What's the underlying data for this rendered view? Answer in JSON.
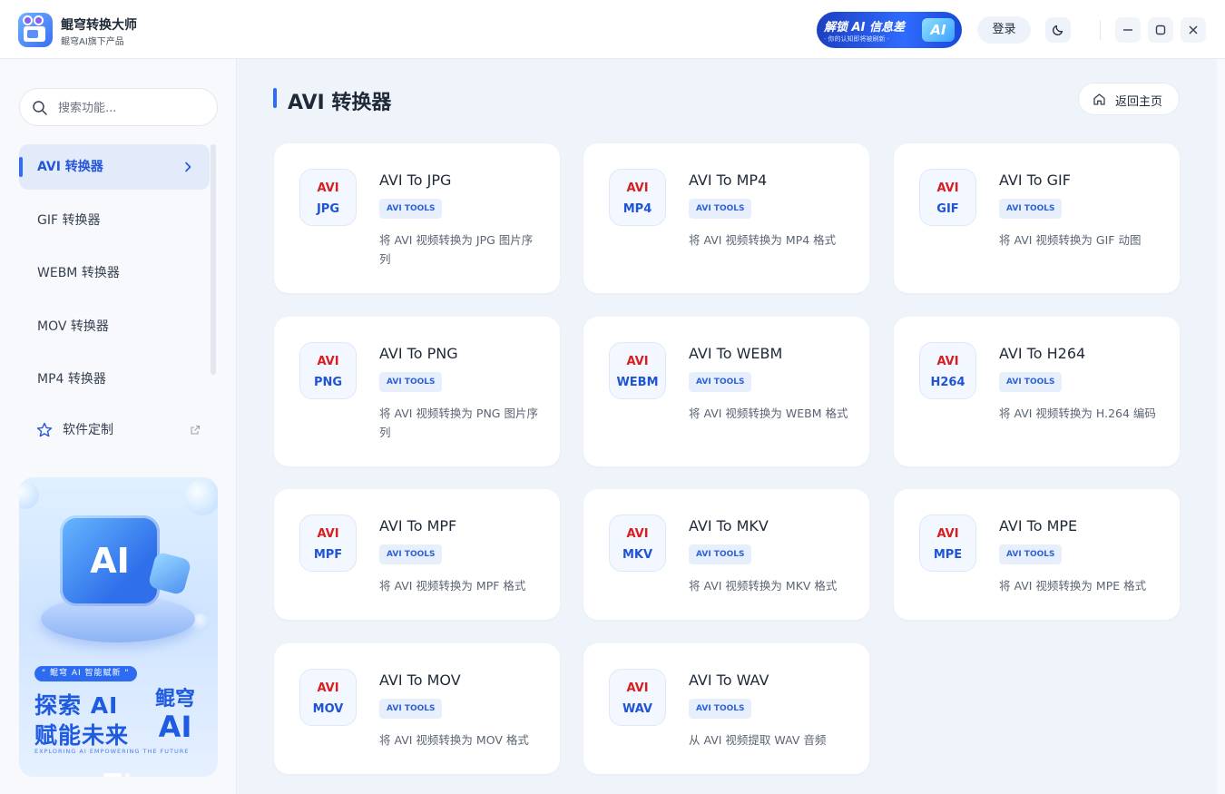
{
  "app": {
    "name": "鲲穹转换大师",
    "subtitle": "鲲穹AI旗下产品"
  },
  "promo": {
    "title": "解锁 AI 信息差",
    "subtitle": "· 你的认知即将被刷新 ·",
    "badge": "AI"
  },
  "titlebar": {
    "login_label": "登录",
    "theme_icon": "moon-icon",
    "minimize_icon": "minimize-icon",
    "maximize_icon": "maximize-icon",
    "close_icon": "close-icon"
  },
  "search": {
    "placeholder": "搜索功能..."
  },
  "sidebar": {
    "items": [
      {
        "label": "AVI 转换器",
        "active": true
      },
      {
        "label": "GIF 转换器"
      },
      {
        "label": "WEBM 转换器"
      },
      {
        "label": "MOV 转换器"
      },
      {
        "label": "MP4 转换器"
      }
    ],
    "custom_label": "软件定制"
  },
  "ad": {
    "cube_text": "AI",
    "tag": "\" 鲲穹 AI  智能赋新 \"",
    "line1": "探索 AI",
    "line2": "赋能未来",
    "brand_top": "鲲穹",
    "brand_big": "AI",
    "english": "EXPLORING AI EMPOWERING THE FUTURE"
  },
  "main": {
    "title": "AVI 转换器",
    "home_label": "返回主页"
  },
  "colors": {
    "accent": "#2f6bff",
    "source_format": "#d71f1f",
    "target_format": "#1f54d6"
  },
  "cards": [
    {
      "src": "AVI",
      "dst": "JPG",
      "title": "AVI To JPG",
      "tag": "AVI TOOLS",
      "desc": "将 AVI 视频转换为 JPG 图片序列"
    },
    {
      "src": "AVI",
      "dst": "MP4",
      "title": "AVI To MP4",
      "tag": "AVI TOOLS",
      "desc": "将 AVI 视频转换为 MP4 格式"
    },
    {
      "src": "AVI",
      "dst": "GIF",
      "title": "AVI To GIF",
      "tag": "AVI TOOLS",
      "desc": "将 AVI 视频转换为 GIF 动图"
    },
    {
      "src": "AVI",
      "dst": "PNG",
      "title": "AVI To PNG",
      "tag": "AVI TOOLS",
      "desc": "将 AVI 视频转换为 PNG 图片序列"
    },
    {
      "src": "AVI",
      "dst": "WEBM",
      "title": "AVI To WEBM",
      "tag": "AVI TOOLS",
      "desc": "将 AVI 视频转换为 WEBM 格式"
    },
    {
      "src": "AVI",
      "dst": "H264",
      "title": "AVI To H264",
      "tag": "AVI TOOLS",
      "desc": "将 AVI 视频转换为 H.264 编码"
    },
    {
      "src": "AVI",
      "dst": "MPF",
      "title": "AVI To MPF",
      "tag": "AVI TOOLS",
      "desc": "将 AVI 视频转换为 MPF 格式"
    },
    {
      "src": "AVI",
      "dst": "MKV",
      "title": "AVI To MKV",
      "tag": "AVI TOOLS",
      "desc": "将 AVI 视频转换为 MKV 格式"
    },
    {
      "src": "AVI",
      "dst": "MPE",
      "title": "AVI To MPE",
      "tag": "AVI TOOLS",
      "desc": "将 AVI 视频转换为 MPE 格式"
    },
    {
      "src": "AVI",
      "dst": "MOV",
      "title": "AVI To MOV",
      "tag": "AVI TOOLS",
      "desc": "将 AVI 视频转换为 MOV 格式"
    },
    {
      "src": "AVI",
      "dst": "WAV",
      "title": "AVI To WAV",
      "tag": "AVI TOOLS",
      "desc": "从 AVI 视频提取 WAV 音频"
    }
  ]
}
